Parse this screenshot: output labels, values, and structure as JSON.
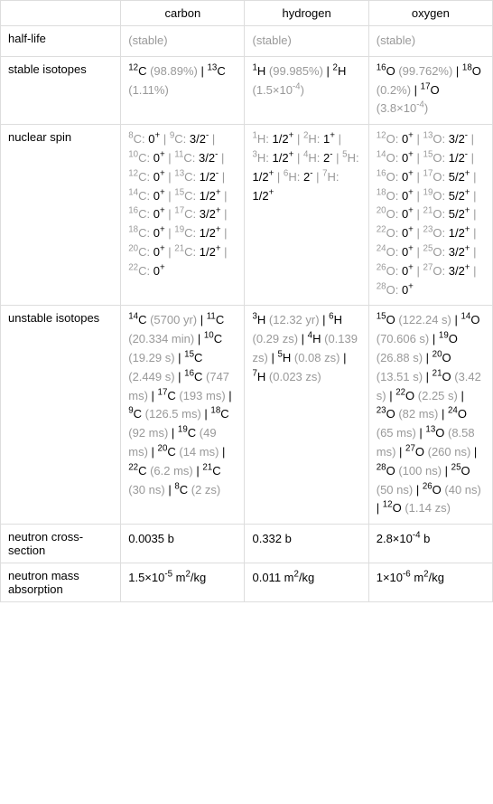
{
  "headers": {
    "col1": "",
    "col2": "carbon",
    "col3": "hydrogen",
    "col4": "oxygen"
  },
  "rows": {
    "halflife": {
      "label": "half-life",
      "carbon": "(stable)",
      "hydrogen": "(stable)",
      "oxygen": "(stable)"
    },
    "stable_isotopes": {
      "label": "stable isotopes",
      "carbon": "<sup>12</sup>C <span class='gray'>(98.89%)</span> | <sup>13</sup>C <span class='gray'>(1.11%)</span>",
      "hydrogen": "<sup>1</sup>H <span class='gray'>(99.985%)</span> | <sup>2</sup>H <span class='gray'>(1.5×10<sup>-4</sup>)</span>",
      "oxygen": "<sup>16</sup>O <span class='gray'>(99.762%)</span> | <sup>18</sup>O <span class='gray'>(0.2%)</span> | <sup>17</sup>O <span class='gray'>(3.8×10<sup>-4</sup>)</span>"
    },
    "nuclear_spin": {
      "label": "nuclear spin",
      "carbon": "<span class='gray'><sup>8</sup>C:</span> 0<sup>+</sup> <span class='gray'>|</span> <span class='gray'><sup>9</sup>C:</span> 3/2<sup>-</sup> <span class='gray'>|</span> <span class='gray'><sup>10</sup>C:</span> 0<sup>+</sup> <span class='gray'>|</span> <span class='gray'><sup>11</sup>C:</span> 3/2<sup>-</sup> <span class='gray'>|</span> <span class='gray'><sup>12</sup>C:</span> 0<sup>+</sup> <span class='gray'>|</span> <span class='gray'><sup>13</sup>C:</span> 1/2<sup>-</sup> <span class='gray'>|</span> <span class='gray'><sup>14</sup>C:</span> 0<sup>+</sup> <span class='gray'>|</span> <span class='gray'><sup>15</sup>C:</span> 1/2<sup>+</sup> <span class='gray'>|</span> <span class='gray'><sup>16</sup>C:</span> 0<sup>+</sup> <span class='gray'>|</span> <span class='gray'><sup>17</sup>C:</span> 3/2<sup>+</sup> <span class='gray'>|</span> <span class='gray'><sup>18</sup>C:</span> 0<sup>+</sup> <span class='gray'>|</span> <span class='gray'><sup>19</sup>C:</span> 1/2<sup>+</sup> <span class='gray'>|</span> <span class='gray'><sup>20</sup>C:</span> 0<sup>+</sup> <span class='gray'>|</span> <span class='gray'><sup>21</sup>C:</span> 1/2<sup>+</sup> <span class='gray'>|</span> <span class='gray'><sup>22</sup>C:</span> 0<sup>+</sup>",
      "hydrogen": "<span class='gray'><sup>1</sup>H:</span> 1/2<sup>+</sup> <span class='gray'>|</span> <span class='gray'><sup>2</sup>H:</span> 1<sup>+</sup> <span class='gray'>|</span> <span class='gray'><sup>3</sup>H:</span> 1/2<sup>+</sup> <span class='gray'>|</span> <span class='gray'><sup>4</sup>H:</span> 2<sup>-</sup> <span class='gray'>|</span> <span class='gray'><sup>5</sup>H:</span> 1/2<sup>+</sup> <span class='gray'>|</span> <span class='gray'><sup>6</sup>H:</span> 2<sup>-</sup> <span class='gray'>|</span> <span class='gray'><sup>7</sup>H:</span> 1/2<sup>+</sup>",
      "oxygen": "<span class='gray'><sup>12</sup>O:</span> 0<sup>+</sup> <span class='gray'>|</span> <span class='gray'><sup>13</sup>O:</span> 3/2<sup>-</sup> <span class='gray'>|</span> <span class='gray'><sup>14</sup>O:</span> 0<sup>+</sup> <span class='gray'>|</span> <span class='gray'><sup>15</sup>O:</span> 1/2<sup>-</sup> <span class='gray'>|</span> <span class='gray'><sup>16</sup>O:</span> 0<sup>+</sup> <span class='gray'>|</span> <span class='gray'><sup>17</sup>O:</span> 5/2<sup>+</sup> <span class='gray'>|</span> <span class='gray'><sup>18</sup>O:</span> 0<sup>+</sup> <span class='gray'>|</span> <span class='gray'><sup>19</sup>O:</span> 5/2<sup>+</sup> <span class='gray'>|</span> <span class='gray'><sup>20</sup>O:</span> 0<sup>+</sup> <span class='gray'>|</span> <span class='gray'><sup>21</sup>O:</span> 5/2<sup>+</sup> <span class='gray'>|</span> <span class='gray'><sup>22</sup>O:</span> 0<sup>+</sup> <span class='gray'>|</span> <span class='gray'><sup>23</sup>O:</span> 1/2<sup>+</sup> <span class='gray'>|</span> <span class='gray'><sup>24</sup>O:</span> 0<sup>+</sup> <span class='gray'>|</span> <span class='gray'><sup>25</sup>O:</span> 3/2<sup>+</sup> <span class='gray'>|</span> <span class='gray'><sup>26</sup>O:</span> 0<sup>+</sup> <span class='gray'>|</span> <span class='gray'><sup>27</sup>O:</span> 3/2<sup>+</sup> <span class='gray'>|</span> <span class='gray'><sup>28</sup>O:</span> 0<sup>+</sup>"
    },
    "unstable_isotopes": {
      "label": "unstable isotopes",
      "carbon": "<sup>14</sup>C <span class='gray'>(5700 yr)</span> | <sup>11</sup>C <span class='gray'>(20.334 min)</span> | <sup>10</sup>C <span class='gray'>(19.29 s)</span> | <sup>15</sup>C <span class='gray'>(2.449 s)</span> | <sup>16</sup>C <span class='gray'>(747 ms)</span> | <sup>17</sup>C <span class='gray'>(193 ms)</span> | <sup>9</sup>C <span class='gray'>(126.5 ms)</span> | <sup>18</sup>C <span class='gray'>(92 ms)</span> | <sup>19</sup>C <span class='gray'>(49 ms)</span> | <sup>20</sup>C <span class='gray'>(14 ms)</span> | <sup>22</sup>C <span class='gray'>(6.2 ms)</span> | <sup>21</sup>C <span class='gray'>(30 ns)</span> | <sup>8</sup>C <span class='gray'>(2 zs)</span>",
      "hydrogen": "<sup>3</sup>H <span class='gray'>(12.32 yr)</span> | <sup>6</sup>H <span class='gray'>(0.29 zs)</span> | <sup>4</sup>H <span class='gray'>(0.139 zs)</span> | <sup>5</sup>H <span class='gray'>(0.08 zs)</span> | <sup>7</sup>H <span class='gray'>(0.023 zs)</span>",
      "oxygen": "<sup>15</sup>O <span class='gray'>(122.24 s)</span> | <sup>14</sup>O <span class='gray'>(70.606 s)</span> | <sup>19</sup>O <span class='gray'>(26.88 s)</span> | <sup>20</sup>O <span class='gray'>(13.51 s)</span> | <sup>21</sup>O <span class='gray'>(3.42 s)</span> | <sup>22</sup>O <span class='gray'>(2.25 s)</span> | <sup>23</sup>O <span class='gray'>(82 ms)</span> | <sup>24</sup>O <span class='gray'>(65 ms)</span> | <sup>13</sup>O <span class='gray'>(8.58 ms)</span> | <sup>27</sup>O <span class='gray'>(260 ns)</span> | <sup>28</sup>O <span class='gray'>(100 ns)</span> | <sup>25</sup>O <span class='gray'>(50 ns)</span> | <sup>26</sup>O <span class='gray'>(40 ns)</span> | <sup>12</sup>O <span class='gray'>(1.14 zs)</span>"
    },
    "neutron_cross_section": {
      "label": "neutron cross-section",
      "carbon": "0.0035 b",
      "hydrogen": "0.332 b",
      "oxygen": "2.8×10<sup>-4</sup> b"
    },
    "neutron_mass_absorption": {
      "label": "neutron mass absorption",
      "carbon": "1.5×10<sup>-5</sup> m<sup>2</sup>/kg",
      "hydrogen": "0.011 m<sup>2</sup>/kg",
      "oxygen": "1×10<sup>-6</sup> m<sup>2</sup>/kg"
    }
  },
  "chart_data": {
    "type": "table",
    "title": "Element nuclear properties comparison",
    "columns": [
      "property",
      "carbon",
      "hydrogen",
      "oxygen"
    ],
    "rows": [
      {
        "property": "half-life",
        "carbon": "(stable)",
        "hydrogen": "(stable)",
        "oxygen": "(stable)"
      },
      {
        "property": "stable isotopes",
        "carbon": "12C (98.89%) | 13C (1.11%)",
        "hydrogen": "1H (99.985%) | 2H (1.5×10^-4)",
        "oxygen": "16O (99.762%) | 18O (0.2%) | 17O (3.8×10^-4)"
      },
      {
        "property": "nuclear spin",
        "carbon": "8C:0+ | 9C:3/2- | 10C:0+ | 11C:3/2- | 12C:0+ | 13C:1/2- | 14C:0+ | 15C:1/2+ | 16C:0+ | 17C:3/2+ | 18C:0+ | 19C:1/2+ | 20C:0+ | 21C:1/2+ | 22C:0+",
        "hydrogen": "1H:1/2+ | 2H:1+ | 3H:1/2+ | 4H:2- | 5H:1/2+ | 6H:2- | 7H:1/2+",
        "oxygen": "12O:0+ | 13O:3/2- | 14O:0+ | 15O:1/2- | 16O:0+ | 17O:5/2+ | 18O:0+ | 19O:5/2+ | 20O:0+ | 21O:5/2+ | 22O:0+ | 23O:1/2+ | 24O:0+ | 25O:3/2+ | 26O:0+ | 27O:3/2+ | 28O:0+"
      },
      {
        "property": "unstable isotopes",
        "carbon": "14C(5700yr)|11C(20.334min)|10C(19.29s)|15C(2.449s)|16C(747ms)|17C(193ms)|9C(126.5ms)|18C(92ms)|19C(49ms)|20C(14ms)|22C(6.2ms)|21C(30ns)|8C(2zs)",
        "hydrogen": "3H(12.32yr)|6H(0.29zs)|4H(0.139zs)|5H(0.08zs)|7H(0.023zs)",
        "oxygen": "15O(122.24s)|14O(70.606s)|19O(26.88s)|20O(13.51s)|21O(3.42s)|22O(2.25s)|23O(82ms)|24O(65ms)|13O(8.58ms)|27O(260ns)|28O(100ns)|25O(50ns)|26O(40ns)|12O(1.14zs)"
      },
      {
        "property": "neutron cross-section",
        "carbon": "0.0035 b",
        "hydrogen": "0.332 b",
        "oxygen": "2.8×10^-4 b"
      },
      {
        "property": "neutron mass absorption",
        "carbon": "1.5×10^-5 m²/kg",
        "hydrogen": "0.011 m²/kg",
        "oxygen": "1×10^-6 m²/kg"
      }
    ]
  }
}
